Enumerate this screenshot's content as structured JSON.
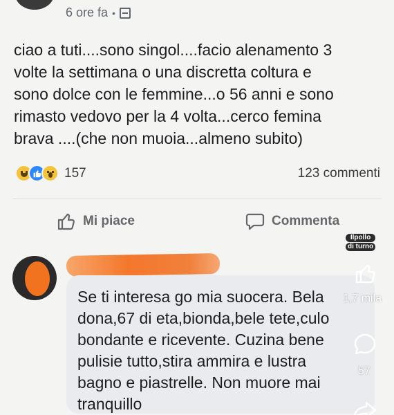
{
  "post": {
    "time": "6 ore fa",
    "separator": "•",
    "text_lines": [
      "ciao a tuti....sono singol....facio alenamento 3",
      "volte la settimana o una discretta coltura e",
      "sono dolce con le femmine...o 56 anni e sono",
      "rimasto vedovo per la 4 volta...cerco femina",
      "brava ....(che non muoia...almeno subito)"
    ],
    "reaction_count": "157",
    "comments_count": "123 commenti",
    "reactions": [
      "haha-icon",
      "like-icon",
      "wow-icon"
    ]
  },
  "actions": {
    "like_label": "Mi piace",
    "comment_label": "Commenta"
  },
  "watermark": {
    "line1": "Ilpollo",
    "line2": "di turno"
  },
  "comment": {
    "text_lines": [
      "Se ti interesa go mia suocera. Bela",
      "dona,67 di eta,bionda,bele tete,culo",
      "bondante e ricevente. Cuzina bene",
      "pulisie tutto,stira ammira e lustra",
      "bagno e piastrelle. Non muore mai",
      "tranquillo"
    ]
  },
  "overlay": {
    "likes_count": "1,7 mila",
    "comments_count": "57"
  },
  "colors": {
    "background": "#f4f5f3",
    "bubble": "#e9ebee",
    "redaction": "#f4772c",
    "like_blue": "#2d88ff",
    "haha_yellow": "#f5c33b"
  }
}
